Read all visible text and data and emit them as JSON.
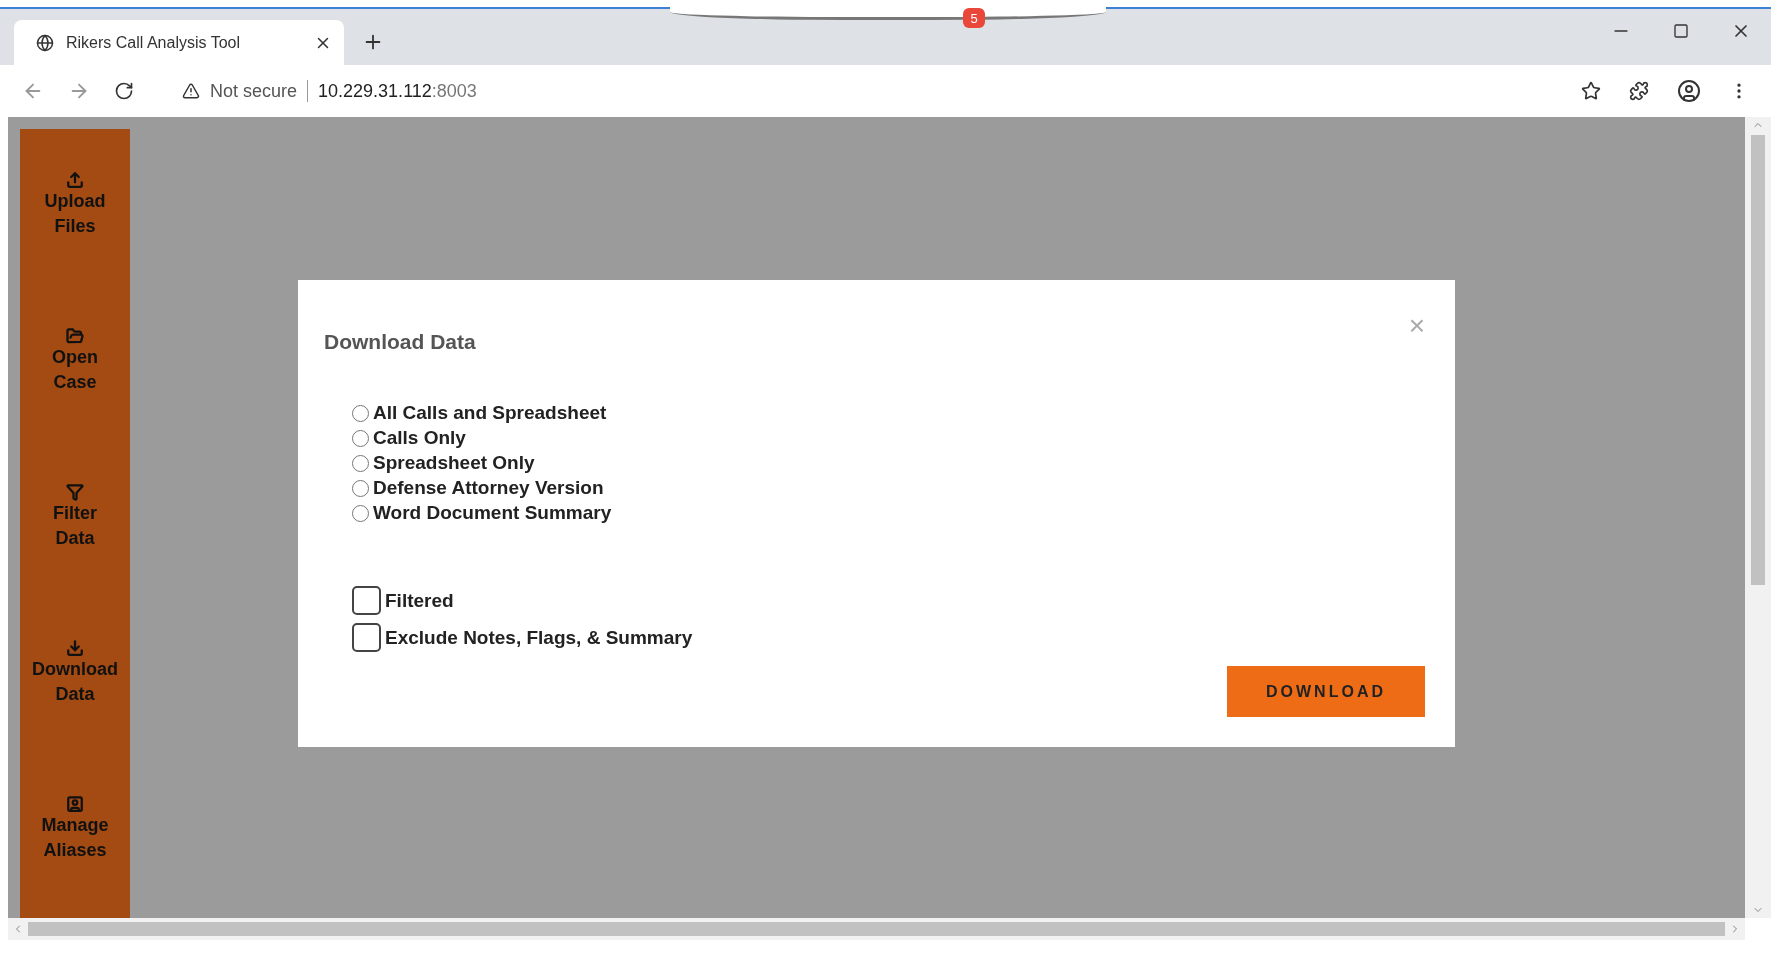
{
  "browser": {
    "tab": {
      "title": "Rikers Call Analysis Tool",
      "selected": true
    },
    "notification_badge": "5",
    "address_bar": {
      "security": "Not secure",
      "host": "10.229.31.112",
      "port": ":8003"
    }
  },
  "sidebar": {
    "items": [
      {
        "kind": "upload",
        "label": "Upload Files"
      },
      {
        "kind": "open",
        "label": "Open Case"
      },
      {
        "kind": "filter",
        "label": "Filter Data"
      },
      {
        "kind": "download",
        "label": "Download Data"
      },
      {
        "kind": "aliases",
        "label": "Manage Aliases"
      }
    ]
  },
  "dialog": {
    "title": "Download Data",
    "close": "×",
    "options": [
      {
        "label": "All Calls and Spreadsheet",
        "selected": false
      },
      {
        "label": "Calls Only",
        "selected": false
      },
      {
        "label": "Spreadsheet Only",
        "selected": false
      },
      {
        "label": "Defense Attorney Version",
        "selected": false
      },
      {
        "label": "Word Document Summary",
        "selected": false
      }
    ],
    "checkboxes": [
      {
        "label": "Filtered",
        "checked": false
      },
      {
        "label": "Exclude Notes, Flags, & Summary",
        "checked": false
      }
    ],
    "button": "DOWNLOAD"
  }
}
